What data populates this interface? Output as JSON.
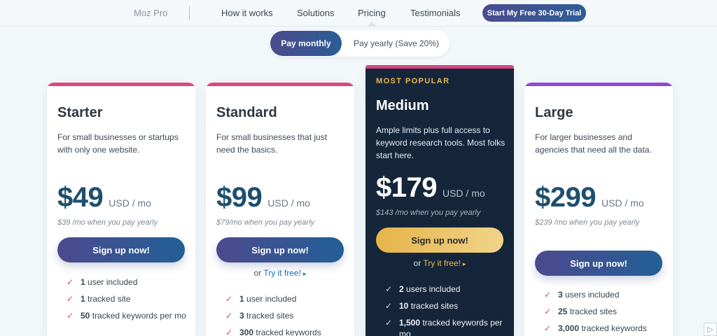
{
  "nav": {
    "brand": "Moz Pro",
    "links": [
      "How it works",
      "Solutions",
      "Pricing",
      "Testimonials"
    ],
    "cta": "Start My Free 30-Day Trial"
  },
  "billing": {
    "monthly": "Pay monthly",
    "yearly": "Pay yearly (Save 20%)"
  },
  "plans": [
    {
      "name": "Starter",
      "description": "For small businesses or startups with only one website.",
      "price": "$49",
      "unit": "USD / mo",
      "yearly": "$39 /mo when you pay yearly",
      "cta": "Sign up now!",
      "features": [
        {
          "strong": "1",
          "text": " user included"
        },
        {
          "strong": "1",
          "text": " tracked site"
        },
        {
          "strong": "50",
          "text": " tracked keywords per mo"
        }
      ],
      "accent": "#e0457b"
    },
    {
      "name": "Standard",
      "description": "For small businesses that just need the basics.",
      "price": "$99",
      "unit": "USD / mo",
      "yearly": "$79/mo when you pay yearly",
      "cta": "Sign up now!",
      "try_prefix": "or ",
      "try_link": "Try it free!",
      "features": [
        {
          "strong": "1",
          "text": " user included"
        },
        {
          "strong": "3",
          "text": " tracked sites"
        },
        {
          "strong": "300",
          "text": " tracked keywords"
        }
      ],
      "accent": "#e0457b"
    },
    {
      "badge": "MOST POPULAR",
      "name": "Medium",
      "description": "Ample limits plus full access to keyword research tools. Most folks start here.",
      "price": "$179",
      "unit": "USD / mo",
      "yearly": "$143 /mo when you pay yearly",
      "cta": "Sign up now!",
      "try_prefix": "or ",
      "try_link": "Try it free!",
      "features": [
        {
          "strong": "2",
          "text": " users included"
        },
        {
          "strong": "10",
          "text": " tracked sites"
        },
        {
          "strong": "1,500",
          "text": " tracked keywords per mo"
        }
      ],
      "accent": "#d6457f"
    },
    {
      "name": "Large",
      "description": "For larger businesses and agencies that need all the data.",
      "price": "$299",
      "unit": "USD / mo",
      "yearly": "$239 /mo when you pay yearly",
      "cta": "Sign up now!",
      "features": [
        {
          "strong": "3",
          "text": " users included"
        },
        {
          "strong": "25",
          "text": " tracked sites"
        },
        {
          "strong": "3,000",
          "text": " tracked keywords"
        }
      ],
      "accent": "#8b4bd8"
    }
  ],
  "icons": {
    "check": "checkmark-icon",
    "arrow": "chevron-right-icon",
    "adchoices": "adchoices-icon"
  }
}
